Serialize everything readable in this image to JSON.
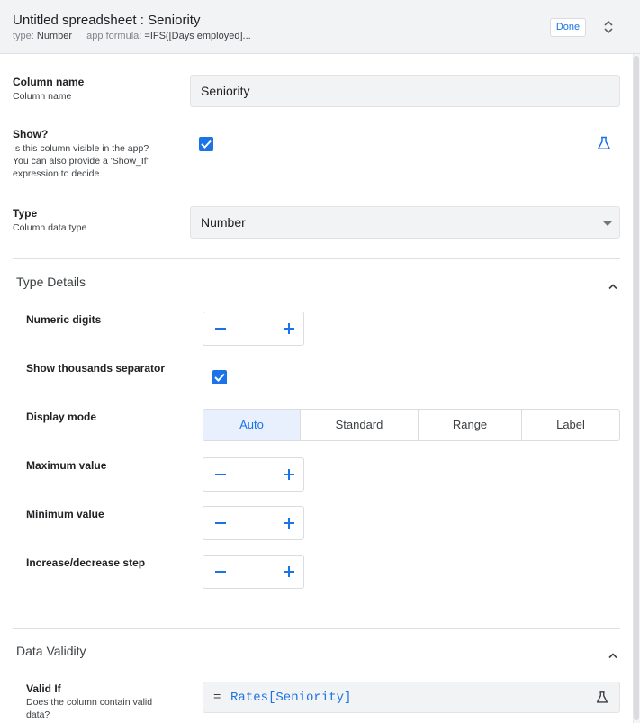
{
  "header": {
    "title": "Untitled spreadsheet : Seniority",
    "type_label": "type:",
    "type_value": "Number",
    "formula_label": "app formula:",
    "formula_value": "=IFS([Days employed]...",
    "done_label": "Done"
  },
  "column_name": {
    "label": "Column name",
    "sublabel": "Column name",
    "value": "Seniority"
  },
  "show": {
    "label": "Show?",
    "sublabel_lines": [
      "Is this column visible in the app?",
      "You can also provide a 'Show_If'",
      "expression to decide."
    ],
    "checked": true
  },
  "type": {
    "label": "Type",
    "sublabel": "Column data type",
    "value": "Number"
  },
  "type_details": {
    "title": "Type Details",
    "numeric_digits": "Numeric digits",
    "thousands_separator": "Show thousands separator",
    "thousands_checked": true,
    "display_mode": "Display mode",
    "display_options": [
      "Auto",
      "Standard",
      "Range",
      "Label"
    ],
    "display_selected": "Auto",
    "maximum_value": "Maximum value",
    "minimum_value": "Minimum value",
    "step": "Increase/decrease step"
  },
  "data_validity": {
    "title": "Data Validity",
    "valid_if_label": "Valid If",
    "valid_if_sublabel_lines": [
      "Does the column contain valid",
      "data?"
    ],
    "formula_eq": "=",
    "formula_expr": "Rates[Seniority]"
  },
  "colors": {
    "accent": "#1a73e8",
    "field_bg": "#f1f3f4",
    "selected_segment_bg": "#e8f0fe"
  },
  "icons": {
    "expression": "flask-icon",
    "collapse": "chevron-up-icon",
    "expand": "unfold-icon"
  }
}
